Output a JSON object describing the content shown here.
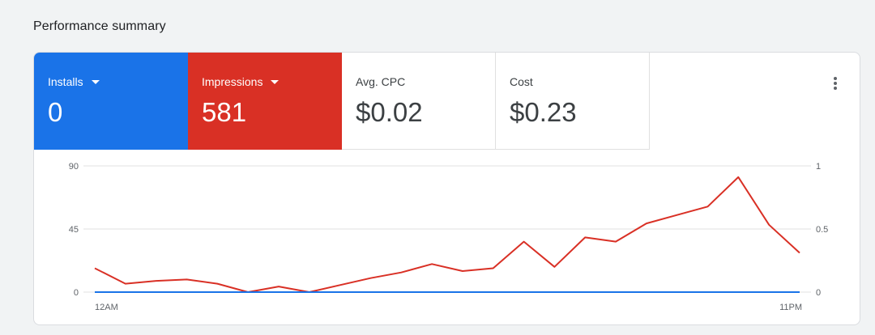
{
  "section": {
    "title": "Performance summary"
  },
  "metrics": [
    {
      "label": "Installs",
      "value": "0",
      "color": "#1a73e8",
      "has_dropdown": true
    },
    {
      "label": "Impressions",
      "value": "581",
      "color": "#d93025",
      "has_dropdown": true
    },
    {
      "label": "Avg. CPC",
      "value": "$0.02",
      "has_dropdown": false
    },
    {
      "label": "Cost",
      "value": "$0.23",
      "has_dropdown": false
    }
  ],
  "more_icon": "more-vert-icon",
  "chart_data": {
    "type": "line",
    "x_labels": [
      "12AM",
      "11PM"
    ],
    "left_axis": {
      "ticks": [
        "0",
        "45",
        "90"
      ],
      "ylim": [
        0,
        90
      ]
    },
    "right_axis": {
      "ticks": [
        "0",
        "0.5",
        "1"
      ],
      "ylim": [
        0,
        1
      ]
    },
    "grid": true,
    "series": [
      {
        "name": "Impressions",
        "axis": "left",
        "color": "#d93025",
        "values": [
          17,
          6,
          8,
          9,
          6,
          0,
          4,
          0,
          5,
          10,
          14,
          20,
          15,
          17,
          36,
          18,
          39,
          36,
          49,
          55,
          61,
          82,
          48,
          28
        ]
      },
      {
        "name": "Installs",
        "axis": "right",
        "color": "#1a73e8",
        "values": [
          0,
          0,
          0,
          0,
          0,
          0,
          0,
          0,
          0,
          0,
          0,
          0,
          0,
          0,
          0,
          0,
          0,
          0,
          0,
          0,
          0,
          0,
          0,
          0
        ]
      }
    ]
  }
}
